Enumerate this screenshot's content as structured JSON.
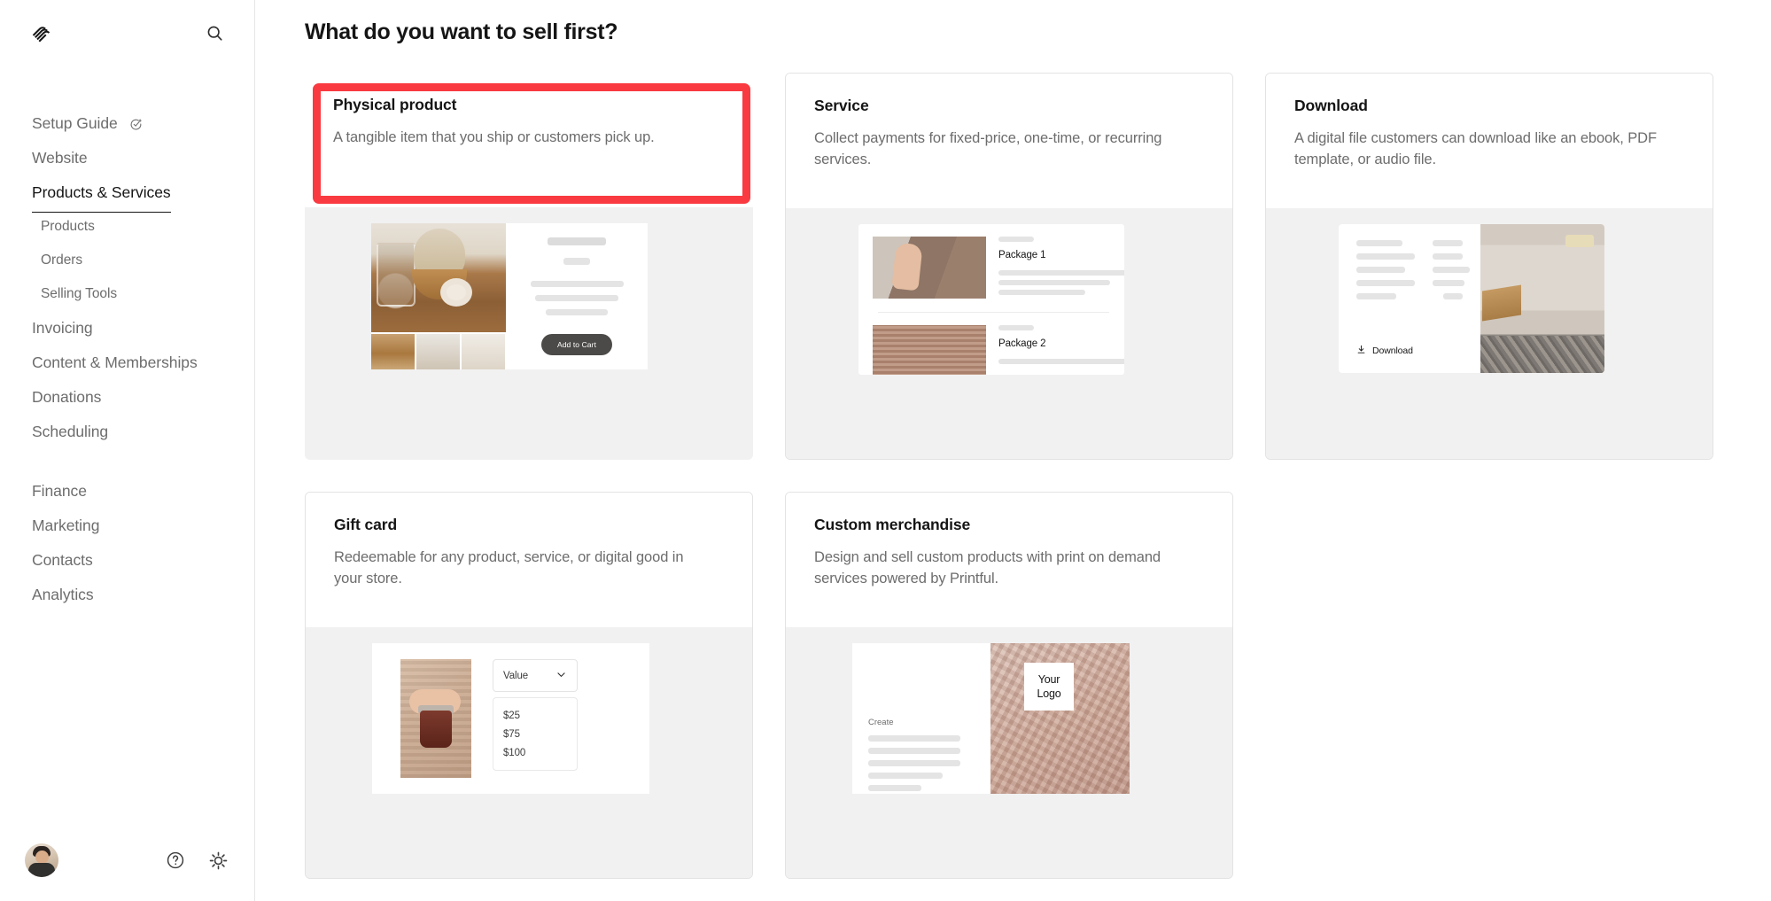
{
  "sidebar": {
    "logo_icon": "squarespace-logo-icon",
    "search_icon": "search-icon",
    "nav": [
      {
        "label": "Setup Guide",
        "level": "top",
        "active": false,
        "icon": "setup-guide-icon"
      },
      {
        "label": "Website",
        "level": "top",
        "active": false
      },
      {
        "label": "Products & Services",
        "level": "top",
        "active": true
      },
      {
        "label": "Products",
        "level": "sub"
      },
      {
        "label": "Orders",
        "level": "sub"
      },
      {
        "label": "Selling Tools",
        "level": "sub"
      },
      {
        "label": "Invoicing",
        "level": "top",
        "active": false
      },
      {
        "label": "Content & Memberships",
        "level": "top",
        "active": false
      },
      {
        "label": "Donations",
        "level": "top",
        "active": false
      },
      {
        "label": "Scheduling",
        "level": "top",
        "active": false
      },
      {
        "label": "Finance",
        "level": "top",
        "active": false
      },
      {
        "label": "Marketing",
        "level": "top",
        "active": false
      },
      {
        "label": "Contacts",
        "level": "top",
        "active": false
      },
      {
        "label": "Analytics",
        "level": "top",
        "active": false
      }
    ],
    "footer": {
      "avatar": "user-avatar",
      "help_icon": "help-circle-icon",
      "settings_icon": "gear-icon"
    }
  },
  "main": {
    "title": "What do you want to sell first?",
    "selection_accent": "#f93a40",
    "cards": [
      {
        "title": "Physical product",
        "desc": "A tangible item that you ship or customers pick up.",
        "selected": true,
        "illustration": {
          "type": "product-page-preview",
          "cta_label": "Add to Cart"
        }
      },
      {
        "title": "Service",
        "desc": "Collect payments for fixed-price, one-time, or recurring services.",
        "selected": false,
        "illustration": {
          "type": "service-packages-preview",
          "rows": [
            {
              "name": "Package 1"
            },
            {
              "name": "Package 2"
            }
          ]
        }
      },
      {
        "title": "Download",
        "desc": "A digital file customers can download like an ebook, PDF template, or audio file.",
        "selected": false,
        "illustration": {
          "type": "download-preview",
          "link_label": "Download",
          "link_icon": "download-icon"
        }
      },
      {
        "title": "Gift card",
        "desc": "Redeemable for any product, service, or digital good in your store.",
        "selected": false,
        "illustration": {
          "type": "gift-card-preview",
          "select_label": "Value",
          "select_icon": "chevron-down-icon",
          "options": [
            "$25",
            "$75",
            "$100"
          ]
        }
      },
      {
        "title": "Custom merchandise",
        "desc": "Design and sell custom products with print on demand services powered by Printful.",
        "selected": false,
        "illustration": {
          "type": "custom-merch-preview",
          "create_label": "Create",
          "logo_label_line1": "Your",
          "logo_label_line2": "Logo"
        }
      }
    ]
  }
}
